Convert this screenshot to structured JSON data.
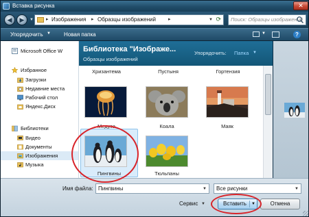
{
  "window": {
    "title": "Вставка рисунка",
    "close_label": "✕"
  },
  "address": {
    "crumbs": [
      "Изображения",
      "Образцы изображений"
    ],
    "search_placeholder": "Поиск: Образцы изображений"
  },
  "toolbar": {
    "organize_label": "Упорядочить",
    "new_folder_label": "Новая папка",
    "help_label": "?"
  },
  "sidebar": {
    "items": [
      {
        "label": "Microsoft Office W",
        "icon": "word-icon"
      },
      {
        "label": "Избранное",
        "icon": "star-icon"
      },
      {
        "label": "Загрузки",
        "icon": "downloads-icon"
      },
      {
        "label": "Недавние места",
        "icon": "recent-places-icon"
      },
      {
        "label": "Рабочий стол",
        "icon": "desktop-icon"
      },
      {
        "label": "Яндекс.Диск",
        "icon": "cloud-icon"
      },
      {
        "label": "Библиотеки",
        "icon": "libraries-icon"
      },
      {
        "label": "Видео",
        "icon": "video-icon"
      },
      {
        "label": "Документы",
        "icon": "documents-icon"
      },
      {
        "label": "Изображения",
        "icon": "pictures-icon",
        "selected": true
      },
      {
        "label": "Музыка",
        "icon": "music-icon"
      }
    ]
  },
  "library": {
    "title": "Библиотека \"Изображе...",
    "subtitle": "Образцы изображений",
    "arrange_label": "Упорядочить:",
    "arrange_value": "Папка"
  },
  "files": {
    "partial_row": [
      "Хризантема",
      "Пустыня",
      "Гортензия"
    ],
    "items": [
      {
        "name": "Медуза"
      },
      {
        "name": "Коала"
      },
      {
        "name": "Маяк"
      },
      {
        "name": "Пингвины",
        "selected": true
      },
      {
        "name": "Тюльпаны"
      }
    ]
  },
  "bottom": {
    "filename_label": "Имя файла:",
    "filename_value": "Пингвины",
    "filter_value": "Все рисунки",
    "service_label": "Сервис",
    "insert_label": "Вставить",
    "cancel_label": "Отмена"
  },
  "colors": {
    "annotation_red": "#d8242a",
    "library_header": "#1f6e97"
  }
}
